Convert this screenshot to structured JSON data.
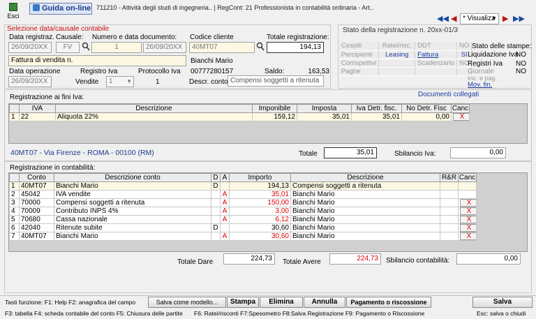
{
  "toolbar": {
    "exit_label": "Esci",
    "guide_label": "Guida on-line",
    "info_text": "711210 - Attività degli studi di ingegneria.. | RegCont: 21 Professionista in contabilità ordinaria - Art..",
    "view_select": "* Visualizz"
  },
  "head": {
    "section_title": "Selezione data/causale contabile",
    "date_reg_label": "Data registraz.",
    "date_reg": "26/09/20XX",
    "causale_label": "Causale:",
    "causale": "FV",
    "num_date_label": "Numero e data documento:",
    "doc_num": "1",
    "doc_date": "26/09/20XX",
    "cliente_label": "Codice cliente",
    "cliente": "40MT07",
    "totale_label": "Totale registrazione:",
    "totale": "194,13",
    "causale_desc": "Fattura di vendita n.",
    "cliente_name": "Bianchi Mario",
    "cliente_piva": "00777280157",
    "saldo_label": "Saldo:",
    "saldo": "163,53",
    "data_op_label": "Data operazione",
    "data_op": "26/09/20XX",
    "reg_iva_label": "Registro Iva",
    "reg_iva": "Vendite",
    "reg_iva_num": "1",
    "protocollo_label": "Protocollo Iva",
    "protocollo": "1",
    "descr_conto_label": "Descr. conto",
    "descr_conto": "Compensi soggetti a ritenuta"
  },
  "status": {
    "title": "Stato della registrazione n. 20xx-01/3",
    "rows": [
      [
        "Cespiti",
        "Ratei/risc.",
        "DDT",
        "NO"
      ],
      [
        "Percipienti",
        "Leasing",
        "Fattura",
        "SI"
      ],
      [
        "Corrispettivi",
        "",
        "Scadenzario",
        "NO"
      ],
      [
        "Paghe",
        "",
        "",
        ""
      ]
    ],
    "prints_title": "Stato delle stampe:",
    "prints": [
      {
        "label": "Liquidazione Iva",
        "value": "NO"
      },
      {
        "label": "Registri Iva",
        "value": "NO"
      },
      {
        "label": "Giornale",
        "value": "NO"
      },
      {
        "label": "Inc. e pag.",
        "value": ""
      },
      {
        "label": "Mov. fin.",
        "value": ""
      }
    ]
  },
  "iva": {
    "section_title": "Registrazione ai fini Iva:",
    "linked_docs": "Documenti collegati",
    "headers": [
      "",
      "IVA",
      "Descrizione",
      "Imponibile",
      "Imposta",
      "Iva Detr. fisc.",
      "No Detr. Fisc",
      "Canc"
    ],
    "rows": [
      [
        "1",
        "22",
        "Aliquota 22%",
        "159,12",
        "35,01",
        "35,01",
        "0,00",
        "X"
      ]
    ],
    "address": "40MT07 - Via Firenze - ROMA - 00100 (RM)",
    "totale_label": "Totale",
    "totale": "35,01",
    "sbilancio_label": "Sbilancio Iva:",
    "sbilancio": "0,00"
  },
  "cont": {
    "section_title": "Registrazione in contabilità:",
    "headers": [
      "",
      "Conto",
      "Descrizione conto",
      "D",
      "A",
      "Importo",
      "Descrizione",
      "R&R",
      "Canc"
    ],
    "rows": [
      {
        "n": "1",
        "conto": "40MT07",
        "desc": "Bianchi Mario",
        "d": "D",
        "a": "",
        "importo": "194,13",
        "descr": "Compensi soggetti a ritenuta",
        "canc": "",
        "red": false
      },
      {
        "n": "2",
        "conto": "45042",
        "desc": "IVA vendite",
        "d": "",
        "a": "A",
        "importo": "35,01",
        "descr": "Bianchi Mario",
        "canc": "",
        "red": true
      },
      {
        "n": "3",
        "conto": "70000",
        "desc": "Compensi soggetti a ritenuta",
        "d": "",
        "a": "A",
        "importo": "150,00",
        "descr": "Bianchi Mario",
        "canc": "X",
        "red": true
      },
      {
        "n": "4",
        "conto": "70009",
        "desc": "Contributo INPS 4%",
        "d": "",
        "a": "A",
        "importo": "3,00",
        "descr": "Bianchi Mario",
        "canc": "X",
        "red": true
      },
      {
        "n": "5",
        "conto": "70680",
        "desc": "Cassa nazionale",
        "d": "",
        "a": "A",
        "importo": "6,12",
        "descr": "Bianchi Mario",
        "canc": "X",
        "red": true
      },
      {
        "n": "6",
        "conto": "42040",
        "desc": "Ritenute subite",
        "d": "D",
        "a": "",
        "importo": "30,60",
        "descr": "Bianchi Mario",
        "canc": "X",
        "red": false
      },
      {
        "n": "7",
        "conto": "40MT07",
        "desc": "Bianchi Mario",
        "d": "",
        "a": "A",
        "importo": "30,60",
        "descr": "Bianchi Mario",
        "canc": "X",
        "red": true
      }
    ],
    "dare_label": "Totale Dare",
    "dare": "224,73",
    "avere_label": "Totale Avere",
    "avere": "224,73",
    "sbil_label": "Sbilancio contabilità:",
    "sbil": "0,00"
  },
  "footer": {
    "keys1": "Tasti funzione: F1: Help  F2: anagrafica del campo",
    "model_btn": "Salva come modello...",
    "stampa": "Stampa",
    "elimina": "Elimina",
    "annulla": "Annulla",
    "pagamento": "Pagamento o riscossione",
    "salva": "Salva",
    "keys2": "F3: tabella   F4: scheda contabile del conto   F5: Chiusura delle partite",
    "keys3": "F6: Ratei/risconti   F7:Spesometro   F8:Salva Registrazione   F9: Pagamento o Riscossione",
    "keys4": "Esc: salva o chiudi"
  }
}
